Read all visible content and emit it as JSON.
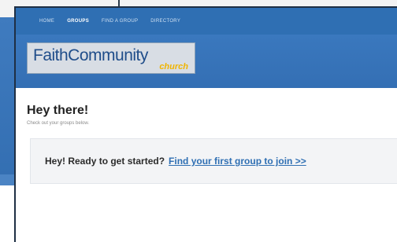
{
  "nav": {
    "items": [
      {
        "label": "HOME",
        "active": false
      },
      {
        "label": "GROUPS",
        "active": true
      },
      {
        "label": "FIND A GROUP",
        "active": false
      },
      {
        "label": "DIRECTORY",
        "active": false
      }
    ]
  },
  "header": {
    "logo_main": "FaithCommunity",
    "logo_sub": "church"
  },
  "main": {
    "title": "Hey there!",
    "subtitle": "Check out your groups below.",
    "cta_text": "Hey! Ready to get started?",
    "cta_link": "Find your first group to join >>"
  },
  "colors": {
    "brand_blue": "#2f6fb3",
    "logo_accent": "#f0b400",
    "panel_bg": "#f3f4f6"
  }
}
